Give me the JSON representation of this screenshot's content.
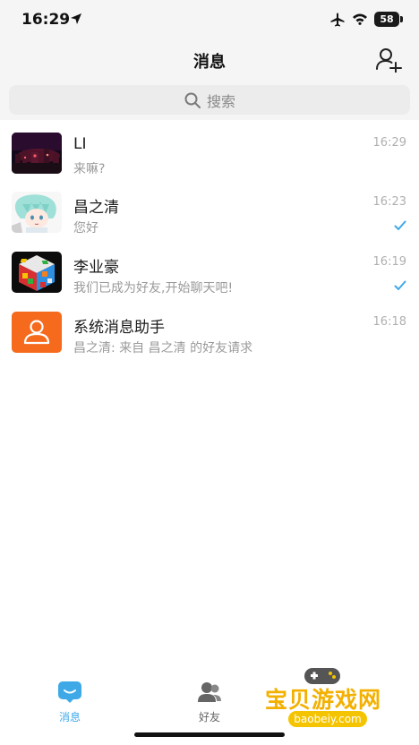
{
  "status_bar": {
    "time": "16:29",
    "battery": "58"
  },
  "nav": {
    "title": "消息"
  },
  "search": {
    "placeholder": "搜索"
  },
  "conversations": [
    {
      "name": "LI",
      "preview": "来嘛?",
      "time": "16:29",
      "read": false,
      "avatar": "night-city-photo"
    },
    {
      "name": "昌之清",
      "preview": "您好",
      "time": "16:23",
      "read": true,
      "avatar": "anime-character"
    },
    {
      "name": "李业豪",
      "preview": "我们已成为好友,开始聊天吧!",
      "time": "16:19",
      "read": true,
      "avatar": "rubiks-cube"
    },
    {
      "name": "系统消息助手",
      "preview": "昌之清: 来自 昌之清 的好友请求",
      "time": "16:18",
      "read": false,
      "avatar": "system-user-icon"
    }
  ],
  "tabs": [
    {
      "label": "消息",
      "active": true
    },
    {
      "label": "好友",
      "active": false
    }
  ],
  "watermark": {
    "title": "宝贝游戏网",
    "url": "baobeiy.com"
  },
  "colors": {
    "accent": "#3fa9e8",
    "system_avatar": "#f56a1d",
    "background": "#f5f5f5"
  }
}
